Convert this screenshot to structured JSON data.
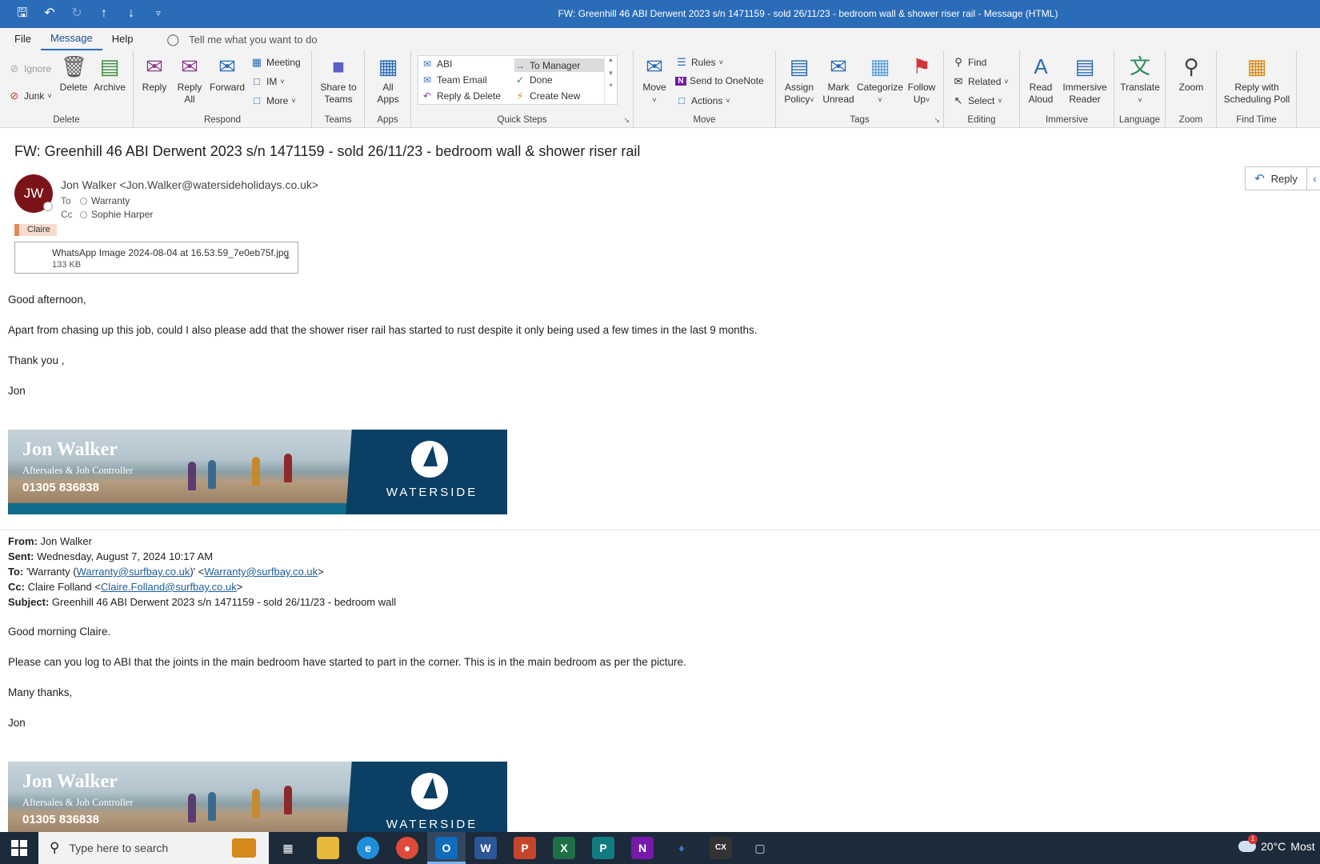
{
  "window": {
    "title": "FW: Greenhill 46 ABI Derwent 2023 s/n 1471159 - sold 26/11/23 - bedroom wall & shower riser rail  -  Message (HTML)"
  },
  "menu": {
    "tabs": [
      "File",
      "Message",
      "Help"
    ],
    "active_tab": "Message",
    "tell_me": "Tell me what you want to do"
  },
  "ribbon": {
    "delete": {
      "label": "Delete",
      "ignore": "Ignore",
      "junk": "Junk",
      "delete": "Delete",
      "archive": "Archive"
    },
    "respond": {
      "label": "Respond",
      "reply": "Reply",
      "reply_all_1": "Reply",
      "reply_all_2": "All",
      "forward": "Forward",
      "meeting": "Meeting",
      "im": "IM",
      "more": "More"
    },
    "teams": {
      "label": "Teams",
      "share_1": "Share to",
      "share_2": "Teams"
    },
    "apps": {
      "label": "Apps",
      "all_apps_1": "All",
      "all_apps_2": "Apps"
    },
    "quick_steps": {
      "label": "Quick Steps",
      "items": [
        "ABI",
        "Team Email",
        "Reply & Delete",
        "To Manager",
        "Done",
        "Create New"
      ]
    },
    "move": {
      "label": "Move",
      "move": "Move",
      "rules": "Rules",
      "onenote": "Send to OneNote",
      "actions": "Actions"
    },
    "tags": {
      "label": "Tags",
      "assign_1": "Assign",
      "assign_2": "Policy",
      "mark_1": "Mark",
      "mark_2": "Unread",
      "categorize": "Categorize",
      "follow_1": "Follow",
      "follow_2": "Up"
    },
    "editing": {
      "label": "Editing",
      "find": "Find",
      "related": "Related",
      "select": "Select"
    },
    "immersive": {
      "label": "Immersive",
      "read_1": "Read",
      "read_2": "Aloud",
      "reader_1": "Immersive",
      "reader_2": "Reader"
    },
    "language": {
      "label": "Language",
      "translate": "Translate"
    },
    "zoom": {
      "label": "Zoom",
      "zoom": "Zoom"
    },
    "find_time": {
      "label": "Find Time",
      "poll_1": "Reply with",
      "poll_2": "Scheduling Poll"
    }
  },
  "message": {
    "subject": "FW: Greenhill 46 ABI Derwent 2023 s/n 1471159 - sold 26/11/23 - bedroom wall & shower riser rail",
    "avatar_initials": "JW",
    "sender": "Jon Walker <Jon.Walker@watersideholidays.co.uk>",
    "to_label": "To",
    "to": "Warranty",
    "cc_label": "Cc",
    "cc": "Sophie Harper",
    "category": "Claire",
    "attachment": {
      "name": "WhatsApp Image 2024-08-04 at 16.53.59_7e0eb75f.jpg",
      "size": "133 KB"
    },
    "reply_button": "Reply"
  },
  "body": {
    "p1": "Good afternoon,",
    "p2": "Apart from chasing up this job, could I also please add that the shower riser rail has started to rust despite it only being used a few times in the last 9 months.",
    "p3": "Thank you ,",
    "p4": "Jon",
    "signature": {
      "name": "Jon Walker",
      "role": "Aftersales & Job Controller",
      "phone": "01305 836838",
      "brand": "WATERSIDE"
    },
    "fwd": {
      "from_label": "From:",
      "from": " Jon Walker",
      "sent_label": "Sent:",
      "sent": " Wednesday, August 7, 2024 10:17 AM",
      "to_label": "To:",
      "to_pre": " 'Warranty (",
      "to_link1": "Warranty@surfbay.co.uk",
      "to_mid": ")' <",
      "to_link2": "Warranty@surfbay.co.uk",
      "to_post": ">",
      "cc_label": "Cc:",
      "cc_pre": " Claire Folland <",
      "cc_link": "Claire.Folland@surfbay.co.uk",
      "cc_post": ">",
      "subject_label": "Subject:",
      "subject": " Greenhill 46 ABI Derwent 2023 s/n 1471159 - sold 26/11/23 - bedroom wall"
    },
    "q1": "Good morning Claire.",
    "q2": "Please can you log to ABI that the joints in the main bedroom have started to part in the corner. This is in the main bedroom as per the picture.",
    "q3": "Many thanks,",
    "q4": "Jon"
  },
  "taskbar": {
    "search_placeholder": "Type here to search",
    "weather": "20°C",
    "weather_extra": "Most",
    "notification_count": "1"
  },
  "colors": {
    "accent": "#2b6cb8",
    "avatar": "#7b1419",
    "banner_blue": "#0b3f63"
  }
}
